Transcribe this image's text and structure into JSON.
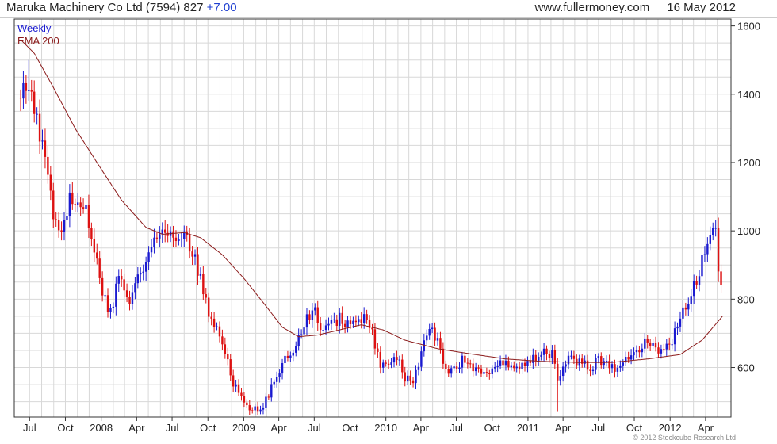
{
  "header": {
    "title": "Maruka Machinery Co Ltd (7594) 827",
    "change": "+7.00",
    "source": "www.fullermoney.com",
    "date": "16 May 2012"
  },
  "legend": {
    "frequency": "Weekly",
    "ma": "EMA 200"
  },
  "copyright": "© 2012 Stockcube Research Ltd",
  "colors": {
    "up": "#1a1ad0",
    "down": "#dd1111",
    "ema": "#8b1a1a",
    "grid": "#d8d8d8",
    "axis": "#333333"
  },
  "chart_data": {
    "type": "candlestick",
    "ylim": [
      455,
      1620
    ],
    "y_ticks": [
      600,
      800,
      1000,
      1200,
      1400,
      1600
    ],
    "x_ticks": [
      "Jul",
      "Oct",
      "2008",
      "Apr",
      "Jul",
      "Oct",
      "2009",
      "Apr",
      "Jul",
      "Oct",
      "2010",
      "Apr",
      "Jul",
      "Oct",
      "2011",
      "Apr",
      "Jul",
      "Oct",
      "2012",
      "Apr"
    ],
    "x_range": [
      "2007-06-08",
      "2012-05-16"
    ],
    "weekly_close_keypoints": [
      [
        "2007-06-08",
        1390
      ],
      [
        "2007-06-29",
        1440
      ],
      [
        "2007-07-20",
        1340
      ],
      [
        "2007-08-10",
        1200
      ],
      [
        "2007-08-31",
        1060
      ],
      [
        "2007-09-21",
        990
      ],
      [
        "2007-10-12",
        1090
      ],
      [
        "2007-11-02",
        1110
      ],
      [
        "2007-11-23",
        1060
      ],
      [
        "2007-12-14",
        950
      ],
      [
        "2008-01-04",
        820
      ],
      [
        "2008-01-25",
        760
      ],
      [
        "2008-02-15",
        870
      ],
      [
        "2008-03-07",
        790
      ],
      [
        "2008-03-28",
        840
      ],
      [
        "2008-04-18",
        890
      ],
      [
        "2008-05-09",
        970
      ],
      [
        "2008-05-30",
        1010
      ],
      [
        "2008-06-20",
        990
      ],
      [
        "2008-07-11",
        960
      ],
      [
        "2008-08-01",
        980
      ],
      [
        "2008-08-22",
        940
      ],
      [
        "2008-09-12",
        860
      ],
      [
        "2008-10-03",
        760
      ],
      [
        "2008-10-24",
        720
      ],
      [
        "2008-11-14",
        640
      ],
      [
        "2008-12-05",
        550
      ],
      [
        "2008-12-26",
        520
      ],
      [
        "2009-01-16",
        485
      ],
      [
        "2009-02-06",
        475
      ],
      [
        "2009-02-27",
        505
      ],
      [
        "2009-03-20",
        560
      ],
      [
        "2009-04-10",
        610
      ],
      [
        "2009-05-01",
        640
      ],
      [
        "2009-05-22",
        690
      ],
      [
        "2009-06-12",
        755
      ],
      [
        "2009-07-03",
        760
      ],
      [
        "2009-07-24",
        710
      ],
      [
        "2009-08-14",
        730
      ],
      [
        "2009-09-04",
        745
      ],
      [
        "2009-09-25",
        730
      ],
      [
        "2009-10-16",
        745
      ],
      [
        "2009-11-06",
        740
      ],
      [
        "2009-11-27",
        700
      ],
      [
        "2009-12-18",
        610
      ],
      [
        "2010-01-08",
        610
      ],
      [
        "2010-01-29",
        630
      ],
      [
        "2010-02-19",
        570
      ],
      [
        "2010-03-12",
        560
      ],
      [
        "2010-04-02",
        640
      ],
      [
        "2010-04-23",
        710
      ],
      [
        "2010-05-14",
        680
      ],
      [
        "2010-06-04",
        590
      ],
      [
        "2010-06-25",
        600
      ],
      [
        "2010-07-16",
        620
      ],
      [
        "2010-08-06",
        610
      ],
      [
        "2010-08-27",
        590
      ],
      [
        "2010-09-17",
        585
      ],
      [
        "2010-10-08",
        600
      ],
      [
        "2010-10-29",
        610
      ],
      [
        "2010-11-19",
        595
      ],
      [
        "2010-12-10",
        610
      ],
      [
        "2010-12-31",
        620
      ],
      [
        "2011-01-21",
        630
      ],
      [
        "2011-02-11",
        650
      ],
      [
        "2011-03-04",
        640
      ],
      [
        "2011-03-18",
        560
      ],
      [
        "2011-04-08",
        620
      ],
      [
        "2011-04-29",
        620
      ],
      [
        "2011-05-20",
        610
      ],
      [
        "2011-06-10",
        600
      ],
      [
        "2011-07-01",
        620
      ],
      [
        "2011-07-22",
        610
      ],
      [
        "2011-08-12",
        600
      ],
      [
        "2011-09-02",
        620
      ],
      [
        "2011-09-23",
        640
      ],
      [
        "2011-10-14",
        660
      ],
      [
        "2011-11-04",
        690
      ],
      [
        "2011-11-25",
        650
      ],
      [
        "2011-12-16",
        660
      ],
      [
        "2012-01-06",
        680
      ],
      [
        "2012-01-27",
        750
      ],
      [
        "2012-02-17",
        790
      ],
      [
        "2012-03-09",
        860
      ],
      [
        "2012-03-30",
        930
      ],
      [
        "2012-04-13",
        980
      ],
      [
        "2012-04-27",
        990
      ],
      [
        "2012-05-04",
        900
      ],
      [
        "2012-05-16",
        827
      ]
    ],
    "ema_keypoints": [
      [
        "2007-06-08",
        1560
      ],
      [
        "2007-07-13",
        1520
      ],
      [
        "2007-08-31",
        1420
      ],
      [
        "2007-10-26",
        1300
      ],
      [
        "2007-12-21",
        1200
      ],
      [
        "2008-02-22",
        1090
      ],
      [
        "2008-04-25",
        1010
      ],
      [
        "2008-06-06",
        990
      ],
      [
        "2008-08-01",
        995
      ],
      [
        "2008-09-12",
        980
      ],
      [
        "2008-11-07",
        930
      ],
      [
        "2009-01-02",
        860
      ],
      [
        "2009-02-27",
        780
      ],
      [
        "2009-04-10",
        718
      ],
      [
        "2009-05-22",
        690
      ],
      [
        "2009-07-10",
        695
      ],
      [
        "2009-09-04",
        710
      ],
      [
        "2009-10-30",
        725
      ],
      [
        "2009-12-25",
        710
      ],
      [
        "2010-02-19",
        680
      ],
      [
        "2010-05-14",
        655
      ],
      [
        "2010-08-06",
        640
      ],
      [
        "2010-11-05",
        625
      ],
      [
        "2011-02-04",
        618
      ],
      [
        "2011-05-06",
        615
      ],
      [
        "2011-08-05",
        615
      ],
      [
        "2011-11-04",
        625
      ],
      [
        "2012-01-27",
        638
      ],
      [
        "2012-03-23",
        680
      ],
      [
        "2012-05-16",
        752
      ]
    ]
  }
}
